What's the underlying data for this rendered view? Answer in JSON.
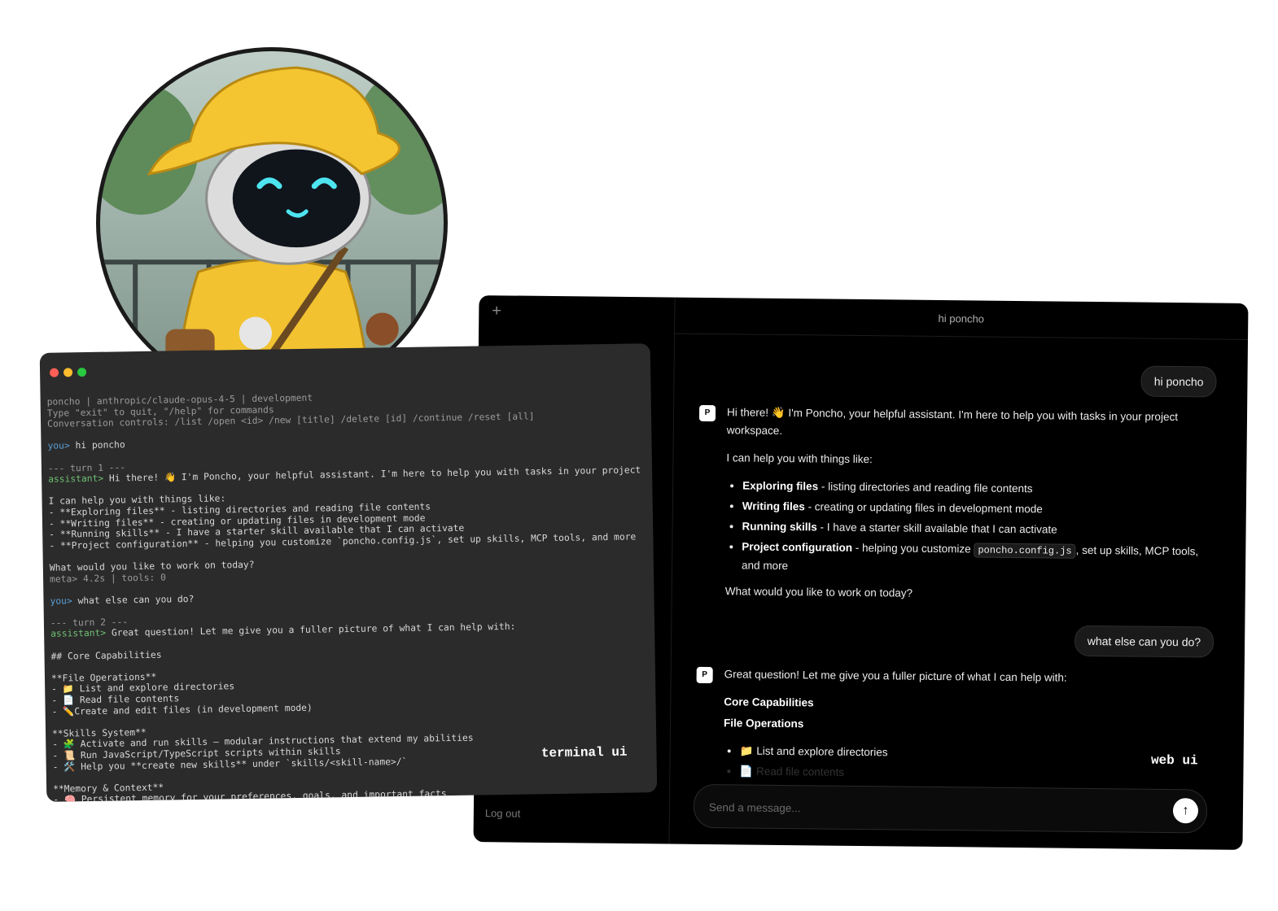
{
  "terminal": {
    "label": "terminal ui",
    "lines": [
      {
        "t": "poncho | anthropic/claude-opus-4-5 | development",
        "c": "dim"
      },
      {
        "t": "Type \"exit\" to quit, \"/help\" for commands",
        "c": "dim"
      },
      {
        "t": "Conversation controls: /list /open <id> /new [title] /delete [id] /continue /reset [all]",
        "c": "dim"
      },
      {
        "t": "",
        "c": ""
      },
      {
        "p": "you>",
        "pc": "prompt",
        "t": " hi poncho",
        "c": ""
      },
      {
        "t": "",
        "c": ""
      },
      {
        "t": "--- turn 1 ---",
        "c": "dim"
      },
      {
        "p": "assistant>",
        "pc": "asst-p",
        "t": " Hi there! 👋 I'm Poncho, your helpful assistant. I'm here to help you with tasks in your project",
        "c": ""
      },
      {
        "t": "",
        "c": ""
      },
      {
        "t": "I can help you with things like:",
        "c": ""
      },
      {
        "t": "- **Exploring files** - listing directories and reading file contents",
        "c": ""
      },
      {
        "t": "- **Writing files** - creating or updating files in development mode",
        "c": ""
      },
      {
        "t": "- **Running skills** - I have a starter skill available that I can activate",
        "c": ""
      },
      {
        "t": "- **Project configuration** - helping you customize `poncho.config.js`, set up skills, MCP tools, and more",
        "c": ""
      },
      {
        "t": "",
        "c": ""
      },
      {
        "t": "What would you like to work on today?",
        "c": ""
      },
      {
        "t": "meta> 4.2s | tools: 0",
        "c": "dim"
      },
      {
        "t": "",
        "c": ""
      },
      {
        "p": "you>",
        "pc": "prompt",
        "t": " what else can you do?",
        "c": ""
      },
      {
        "t": "",
        "c": ""
      },
      {
        "t": "--- turn 2 ---",
        "c": "dim"
      },
      {
        "p": "assistant>",
        "pc": "asst-p",
        "t": " Great question! Let me give you a fuller picture of what I can help with:",
        "c": ""
      },
      {
        "t": "",
        "c": ""
      },
      {
        "t": "## Core Capabilities",
        "c": ""
      },
      {
        "t": "",
        "c": ""
      },
      {
        "t": "**File Operations**",
        "c": ""
      },
      {
        "t": "- 📁 List and explore directories",
        "c": ""
      },
      {
        "t": "- 📄 Read file contents",
        "c": ""
      },
      {
        "t": "- ✏️Create and edit files (in development mode)",
        "c": ""
      },
      {
        "t": "",
        "c": ""
      },
      {
        "t": "**Skills System**",
        "c": ""
      },
      {
        "t": "- 🧩 Activate and run skills — modular instructions that extend my abilities",
        "c": ""
      },
      {
        "t": "- 📜 Run JavaScript/TypeScript scripts within skills",
        "c": ""
      },
      {
        "t": "- 🛠️ Help you **create new skills** under `skills/<skill-name>/`",
        "c": ""
      },
      {
        "t": "",
        "c": ""
      },
      {
        "t": "**Memory & Context**",
        "c": ""
      },
      {
        "t": "- 🧠 Persistent memory for your preferences, goals, and important facts",
        "c": ""
      }
    ]
  },
  "web": {
    "label": "web ui",
    "new_chat": "+",
    "logout": "Log out",
    "header_title": "hi poncho",
    "avatar_letter": "P",
    "user_msg_1": "hi poncho",
    "user_msg_2": "what else can you do?",
    "asst_1": {
      "intro": "Hi there! 👋 I'm Poncho, your helpful assistant. I'm here to help you with tasks in your project workspace.",
      "lead": "I can help you with things like:",
      "items": [
        {
          "bold": "Exploring files",
          "text": " - listing directories and reading file contents"
        },
        {
          "bold": "Writing files",
          "text": " - creating or updating files in development mode"
        },
        {
          "bold": "Running skills",
          "text": " - I have a starter skill available that I can activate"
        },
        {
          "bold": "Project configuration",
          "text_pre": " - helping you customize ",
          "code": "poncho.config.js",
          "text_post": ", set up skills, MCP tools, and more"
        }
      ],
      "closing": "What would you like to work on today?"
    },
    "asst_2": {
      "intro": "Great question! Let me give you a fuller picture of what I can help with:",
      "heading_1": "Core Capabilities",
      "heading_2": "File Operations",
      "item_1": "📁 List and explore directories",
      "item_2": "📄 Read file contents"
    },
    "composer_placeholder": "Send a message...",
    "send_icon": "↑"
  }
}
